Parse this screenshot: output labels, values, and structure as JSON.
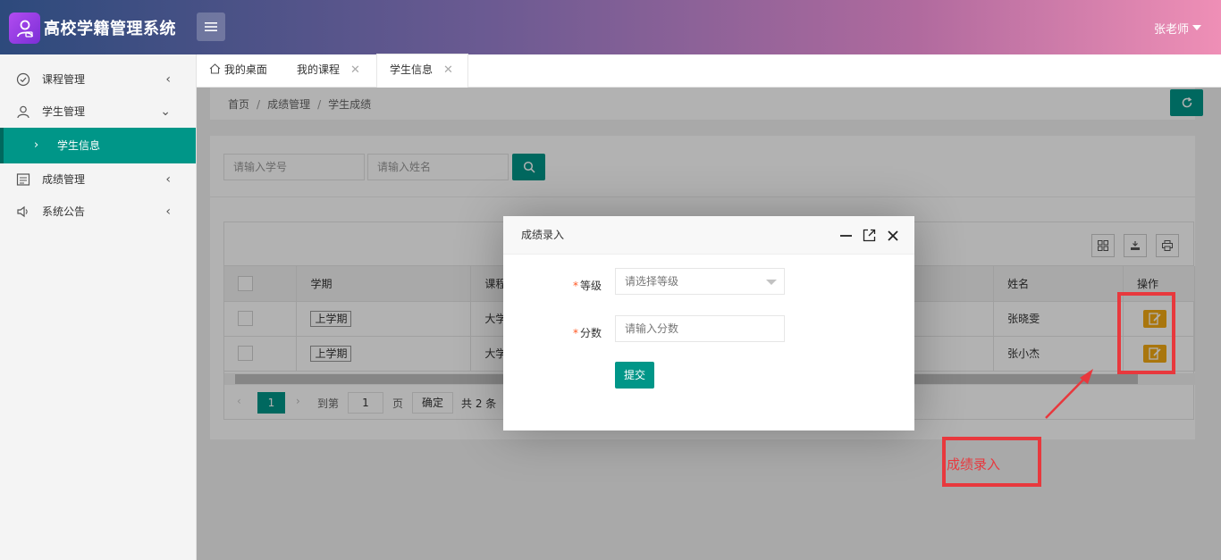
{
  "header": {
    "app_title": "高校学籍管理系统",
    "user_name": "张老师"
  },
  "sidebar": {
    "items": [
      {
        "label": "课程管理",
        "icon": "check-circle-icon"
      },
      {
        "label": "学生管理",
        "icon": "user-icon"
      },
      {
        "label": "学生信息",
        "sub": true
      },
      {
        "label": "成绩管理",
        "icon": "form-icon"
      },
      {
        "label": "系统公告",
        "icon": "speaker-icon"
      }
    ]
  },
  "tabs": [
    {
      "label": "我的桌面",
      "icon": "home-icon"
    },
    {
      "label": "我的课程"
    },
    {
      "label": "学生信息",
      "active": true
    }
  ],
  "breadcrumb": [
    "首页",
    "成绩管理",
    "学生成绩"
  ],
  "search": {
    "student_no_placeholder": "请输入学号",
    "name_placeholder": "请输入姓名"
  },
  "table": {
    "headers": {
      "term": "学期",
      "course": "课程",
      "name": "姓名",
      "action": "操作"
    },
    "rows": [
      {
        "term": "上学期",
        "course": "大学",
        "name": "张晓雯"
      },
      {
        "term": "上学期",
        "course": "大学",
        "name": "张小杰"
      }
    ]
  },
  "pager": {
    "current_page": "1",
    "goto_label": "到第",
    "page_input": "1",
    "page_unit": "页",
    "confirm_label": "确定",
    "total": "共 2 条"
  },
  "dialog": {
    "title": "成绩录入",
    "grade_label": "等级",
    "grade_placeholder": "请选择等级",
    "score_label": "分数",
    "score_placeholder": "请输入分数",
    "submit_label": "提交"
  },
  "annotation": {
    "callout": "成绩录入",
    "color": "#e8383d"
  },
  "colors": {
    "accent": "#009688",
    "edit_button": "#f3a914"
  }
}
